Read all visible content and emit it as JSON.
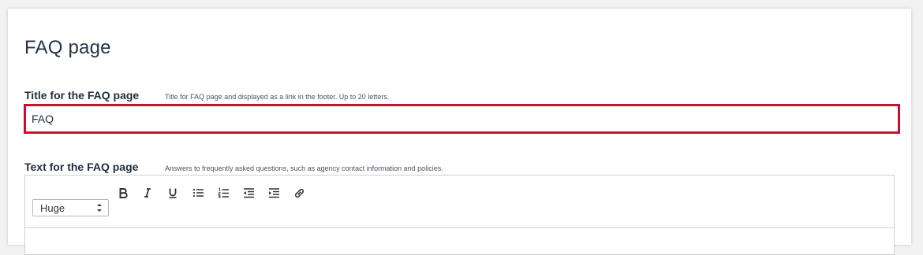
{
  "page": {
    "title": "FAQ page"
  },
  "faq_title_field": {
    "label": "Title for the FAQ page",
    "help": "Title for FAQ page and displayed as a link in the footer. Up to 20 letters.",
    "value": "FAQ",
    "border_color": "#c8102e"
  },
  "faq_text_field": {
    "label": "Text for the FAQ page",
    "help": "Answers to frequently asked questions, such as agency contact information and policies.",
    "toolbar": {
      "size_select": {
        "selected": "Huge"
      },
      "buttons": [
        {
          "name": "bold",
          "icon": "bold-icon"
        },
        {
          "name": "italic",
          "icon": "italic-icon"
        },
        {
          "name": "underline",
          "icon": "underline-icon"
        },
        {
          "name": "bullet-list",
          "icon": "bullet-list-icon"
        },
        {
          "name": "numbered-list",
          "icon": "numbered-list-icon"
        },
        {
          "name": "outdent",
          "icon": "outdent-icon"
        },
        {
          "name": "indent",
          "icon": "indent-icon"
        },
        {
          "name": "link",
          "icon": "link-icon"
        }
      ]
    }
  }
}
